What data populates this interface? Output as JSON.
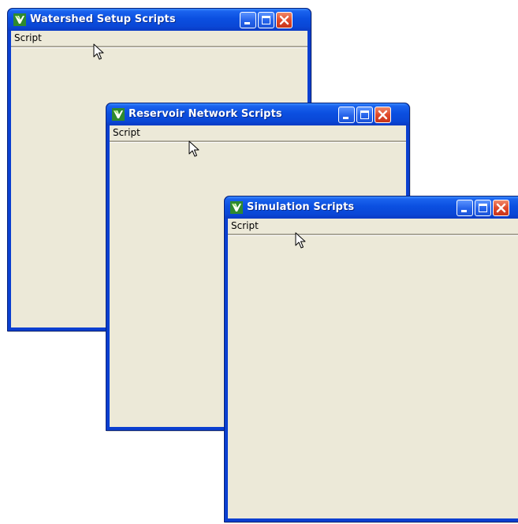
{
  "windows": [
    {
      "title": "Watershed Setup Scripts",
      "menu": [
        "Script"
      ]
    },
    {
      "title": "Reservoir Network Scripts",
      "menu": [
        "Script"
      ]
    },
    {
      "title": "Simulation Scripts",
      "menu": [
        "Script"
      ]
    }
  ],
  "title_buttons": [
    "minimize",
    "maximize",
    "close"
  ],
  "icons": {
    "app": "app-icon",
    "minimize": "minimize-icon",
    "maximize": "maximize-icon",
    "close": "close-icon",
    "cursor": "mouse-pointer-icon"
  },
  "colors": {
    "titlebar": "#0b4fe0",
    "client": "#ece9d8",
    "close_button": "#e0492a"
  }
}
